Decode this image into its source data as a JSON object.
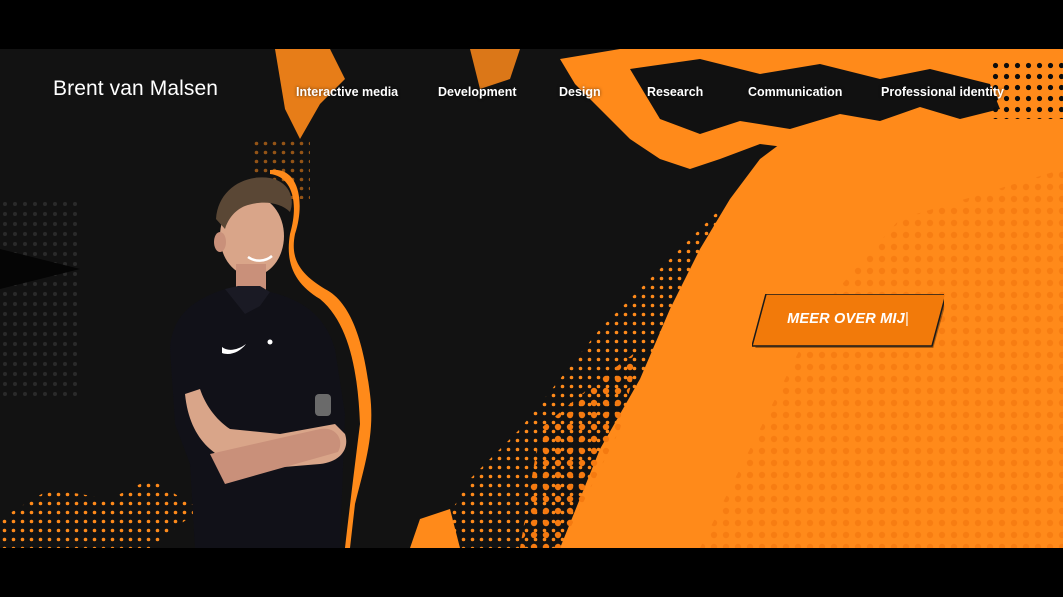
{
  "site": {
    "brand": "Brent van Malsen"
  },
  "nav": {
    "items": [
      {
        "id": "interactive-media",
        "label": "Interactive media"
      },
      {
        "id": "development",
        "label": "Development"
      },
      {
        "id": "design",
        "label": "Design"
      },
      {
        "id": "research",
        "label": "Research"
      },
      {
        "id": "communication",
        "label": "Communication"
      },
      {
        "id": "professional-identity",
        "label": "Professional identity"
      }
    ]
  },
  "hero": {
    "cta_label": "MEER OVER MIJ",
    "cursor": "|"
  },
  "colors": {
    "accent": "#ff8a1a",
    "accent_dark": "#f27a0a",
    "background": "#121212",
    "text": "#ffffff"
  }
}
